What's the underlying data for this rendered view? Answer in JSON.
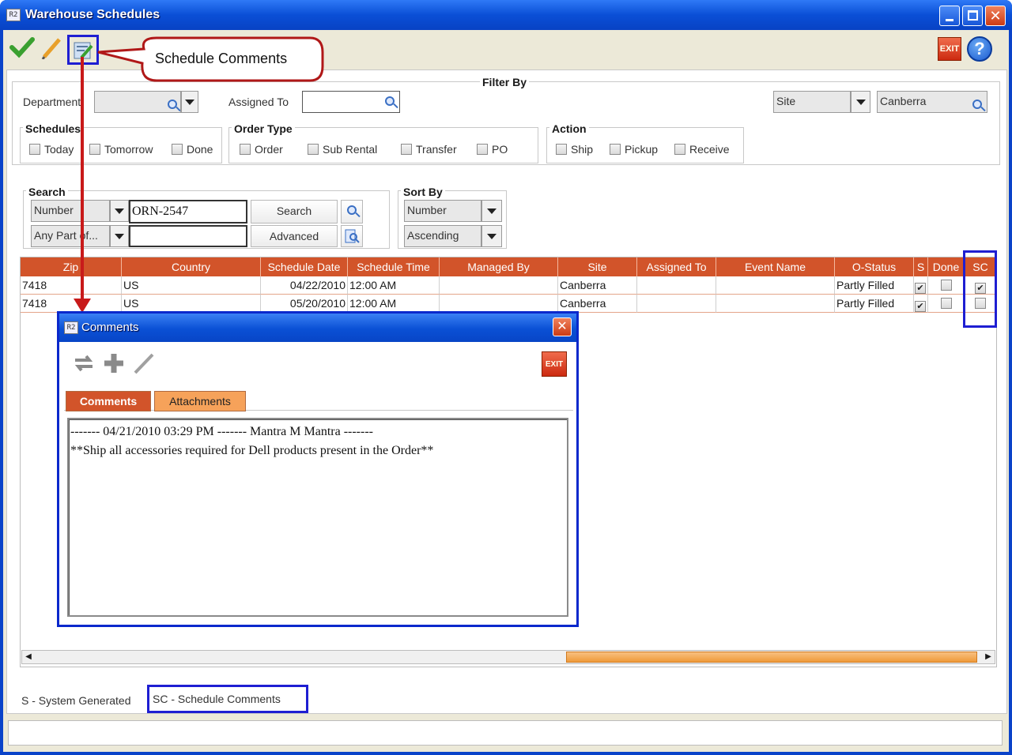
{
  "window": {
    "title": "Warehouse Schedules",
    "app_icon_text": "R2"
  },
  "toolbar": {
    "exit_label": "EXIT",
    "help_label": "?"
  },
  "callout": {
    "text": "Schedule Comments"
  },
  "filter": {
    "title": "Filter By",
    "department_label": "Department",
    "department_value": "",
    "assigned_to_label": "Assigned To",
    "assigned_to_value": "",
    "site_field_value": "Site",
    "site_value": "Canberra",
    "schedules": {
      "legend": "Schedules",
      "options": [
        {
          "label": "Today",
          "checked": false
        },
        {
          "label": "Tomorrow",
          "checked": false
        },
        {
          "label": "Done",
          "checked": false
        }
      ]
    },
    "order_type": {
      "legend": "Order Type",
      "options": [
        {
          "label": "Order",
          "checked": false
        },
        {
          "label": "Sub Rental",
          "checked": false
        },
        {
          "label": "Transfer",
          "checked": false
        },
        {
          "label": "PO",
          "checked": false
        }
      ]
    },
    "action": {
      "legend": "Action",
      "options": [
        {
          "label": "Ship",
          "checked": false
        },
        {
          "label": "Pickup",
          "checked": false
        },
        {
          "label": "Receive",
          "checked": false
        }
      ]
    }
  },
  "search": {
    "legend": "Search",
    "field1": "Number",
    "value1": "ORN-2547",
    "field2": "Any Part of...",
    "value2": "",
    "search_btn": "Search",
    "advanced_btn": "Advanced"
  },
  "sort": {
    "legend": "Sort By",
    "field": "Number",
    "order": "Ascending"
  },
  "grid": {
    "columns": [
      "Zip",
      "Country",
      "Schedule Date",
      "Schedule Time",
      "Managed By",
      "Site",
      "Assigned To",
      "Event Name",
      "O-Status",
      "S",
      "Done",
      "SC"
    ],
    "rows": [
      {
        "zip": "7418",
        "country": "US",
        "date": "04/22/2010",
        "time": "12:00 AM",
        "managed_by": "",
        "site": "Canberra",
        "assigned_to": "",
        "event": "",
        "status": "Partly Filled",
        "s": true,
        "done": false,
        "sc": true
      },
      {
        "zip": "7418",
        "country": "US",
        "date": "05/20/2010",
        "time": "12:00 AM",
        "managed_by": "",
        "site": "Canberra",
        "assigned_to": "",
        "event": "",
        "status": "Partly Filled",
        "s": true,
        "done": false,
        "sc": false
      }
    ]
  },
  "legend_bar": {
    "s": "S - System Generated",
    "sc": "SC - Schedule Comments"
  },
  "comments_dialog": {
    "title": "Comments",
    "exit_label": "EXIT",
    "tabs": [
      "Comments",
      "Attachments"
    ],
    "active_tab": "Comments",
    "lines": [
      "------- 04/21/2010 03:29 PM ------- Mantra M Mantra -------",
      "**Ship all accessories required for Dell products present in the Order**"
    ]
  },
  "colors": {
    "header_orange": "#d2542a",
    "titlebar_blue": "#0a4fd6",
    "highlight_blue": "#1e1ed2",
    "callout_red": "#b01818"
  }
}
